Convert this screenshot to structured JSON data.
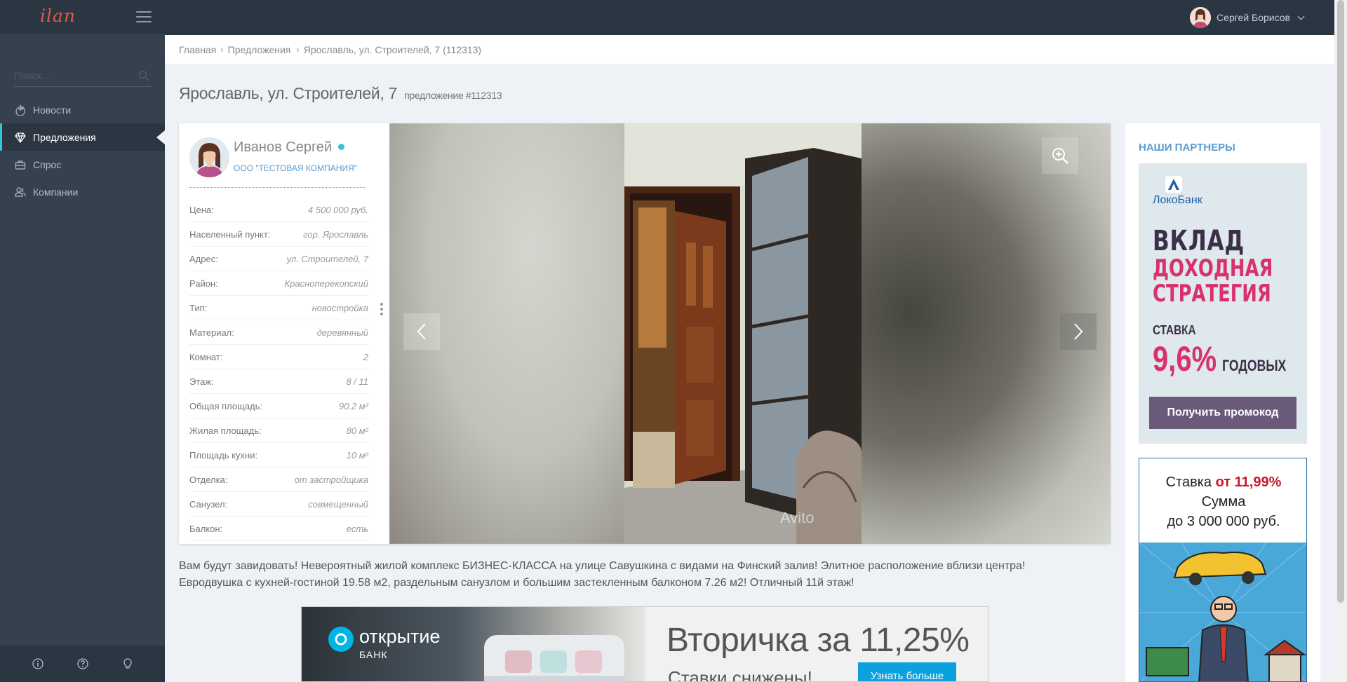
{
  "app": {
    "logo": "ilan"
  },
  "topbar": {
    "user_name": "Сергей Борисов"
  },
  "sidebar": {
    "search_placeholder": "Поиск...",
    "items": [
      {
        "label": "Новости",
        "icon": "flame-icon",
        "active": false
      },
      {
        "label": "Предложения",
        "icon": "diamond-icon",
        "active": true
      },
      {
        "label": "Спрос",
        "icon": "briefcase-icon",
        "active": false
      },
      {
        "label": "Компании",
        "icon": "users-icon",
        "active": false
      }
    ],
    "footer_icons": [
      "info-icon",
      "help-icon",
      "lightbulb-icon"
    ]
  },
  "breadcrumb": {
    "items": [
      "Главная",
      "Предложения",
      "Ярославль, ул. Строителей, 7 (112313)"
    ]
  },
  "page": {
    "title": "Ярославль, ул. Строителей, 7",
    "subtitle": "предложение #112313"
  },
  "agent": {
    "name": "Иванов Сергей",
    "company": "ООО \"ТЕСТОВАЯ КОМПАНИЯ\"",
    "online": true
  },
  "properties": [
    {
      "label": "Цена:",
      "value": "4 500 000 руб."
    },
    {
      "label": "Населенный пункт:",
      "value": "гор. Ярославль"
    },
    {
      "label": "Адрес:",
      "value": "ул. Строителей, 7"
    },
    {
      "label": "Район:",
      "value": "Красноперекопский"
    },
    {
      "label": "Тип:",
      "value": "новостройка"
    },
    {
      "label": "Материал:",
      "value": "деревянный"
    },
    {
      "label": "Комнат:",
      "value": "2"
    },
    {
      "label": "Этаж:",
      "value": "8 / 11"
    },
    {
      "label": "Общая площадь:",
      "value": "90.2 м²"
    },
    {
      "label": "Жилая площадь:",
      "value": "80 м²"
    },
    {
      "label": "Площадь кухни:",
      "value": "10 м²"
    },
    {
      "label": "Отделка:",
      "value": "от застройщика"
    },
    {
      "label": "Санузел:",
      "value": "совмещенный"
    },
    {
      "label": "Балкон:",
      "value": "есть"
    }
  ],
  "gallery": {
    "watermark": "Avito"
  },
  "description": {
    "line1": "Вам будут завидовать! Невероятный жилой комплекс БИЗНЕС-КЛАССА на улице Савушкина с видами на Финский залив! Элитное расположение вблизи центра!",
    "line2": "Евродвушка с кухней-гостиной 19.58 м2, раздельным санузлом и большим застекленным балконом 7.26 м2! Отличный 11й этаж!"
  },
  "bank_banner": {
    "brand": "открытие",
    "brand_sub": "БАНК",
    "headline": "Вторичка за 11,25%",
    "subline": "Ставки снижены!",
    "button": "Узнать больше",
    "accent_color": "#0ba1dd"
  },
  "partners": {
    "title": "НАШИ ПАРТНЕРЫ",
    "ad1": {
      "brand": "ЛокоБанк",
      "line1": "ВКЛАД",
      "line2": "ДОХОДНАЯ",
      "line3": "СТРАТЕГИЯ",
      "rate_label": "СТАВКА",
      "rate": "9,6%",
      "rate_suffix": "ГОДОВЫХ",
      "button": "Получить промокод"
    },
    "ad2": {
      "line1_prefix": "Ставка ",
      "line1_highlight": "от 11,99%",
      "line2": "Сумма",
      "line3": "до 3 000 000 руб."
    }
  },
  "colors": {
    "topbar": "#2b3643",
    "sidebar": "#364150",
    "accent": "#36c6d3",
    "link": "#5b9bd1",
    "logo": "#e2574c"
  }
}
